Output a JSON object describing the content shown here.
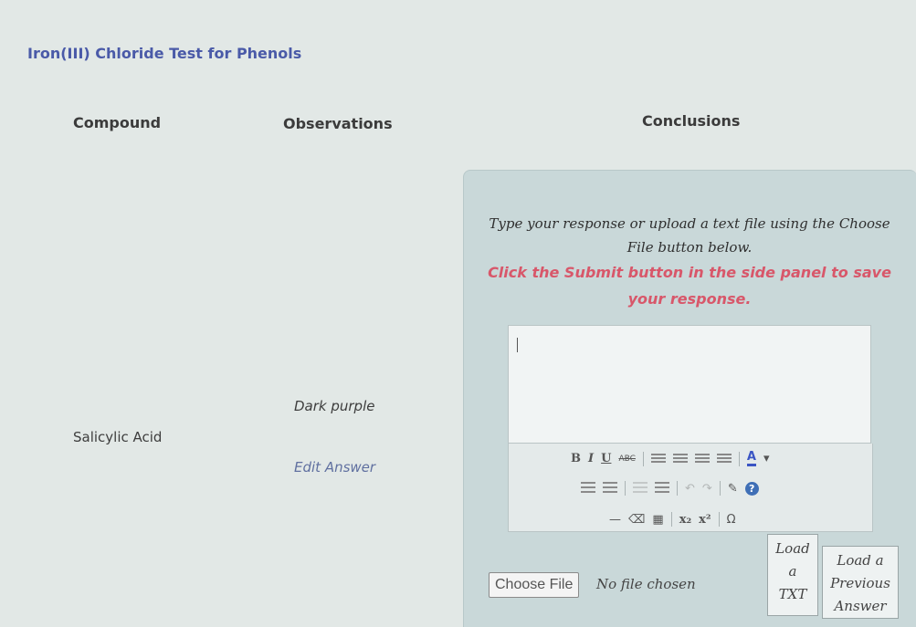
{
  "section": {
    "title": "Iron(III) Chloride Test for Phenols"
  },
  "table": {
    "headers": {
      "compound": "Compound",
      "observations": "Observations",
      "conclusions": "Conclusions"
    },
    "row": {
      "compound": "Salicylic Acid",
      "observation": "Dark purple",
      "edit_label": "Edit Answer"
    }
  },
  "response_panel": {
    "instruction_line1": "Type your response or upload a text file using the Choose",
    "instruction_line2": "File button below.",
    "warning_line1": "Click the Submit button in the side panel to save",
    "warning_line2": "your response.",
    "editor_value": ""
  },
  "toolbar": {
    "bold": "B",
    "italic": "I",
    "underline": "U",
    "strike": "ABC",
    "font_color": "A",
    "dropdown": "▾",
    "subscript": "x₂",
    "superscript": "x²",
    "omega": "Ω",
    "help": "?"
  },
  "file_upload": {
    "choose_file_label": "Choose File",
    "status": "No file chosen"
  },
  "buttons": {
    "load_txt": [
      "Load",
      "a",
      "TXT"
    ],
    "load_previous": [
      "Load a",
      "Previous",
      "Answer"
    ]
  },
  "colors": {
    "title": "#4a5aa8",
    "warning": "#d8576a",
    "panel": "#c9d8d9",
    "link": "#6070a0"
  }
}
